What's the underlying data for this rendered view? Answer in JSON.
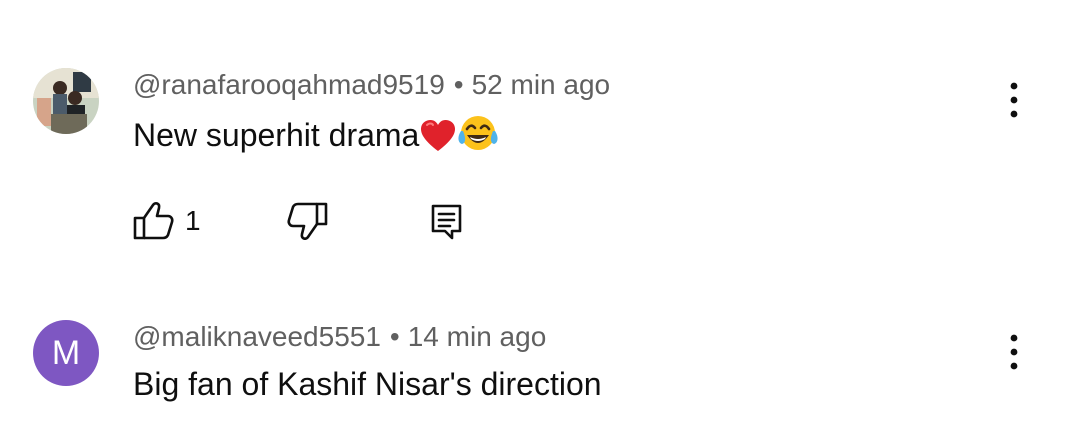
{
  "comments": [
    {
      "author": "@ranafarooqahmad9519",
      "separator": "•",
      "time": "52 min ago",
      "text": "New superhit drama",
      "emoji_icons": [
        "red-heart-emoji",
        "tears-of-joy-emoji"
      ],
      "avatar": "photo-avatar",
      "likes": "1",
      "actions": [
        "like-icon",
        "dislike-icon",
        "reply-icon"
      ]
    },
    {
      "author": "@maliknaveed5551",
      "separator": "•",
      "time": "14 min ago",
      "text": "Big fan of Kashif Nisar's direction",
      "avatar_letter": "M",
      "avatar_color": "#7e57c2"
    }
  ],
  "colors": {
    "text_primary": "#0f0f0f",
    "text_secondary": "#606060",
    "background": "#ffffff"
  }
}
